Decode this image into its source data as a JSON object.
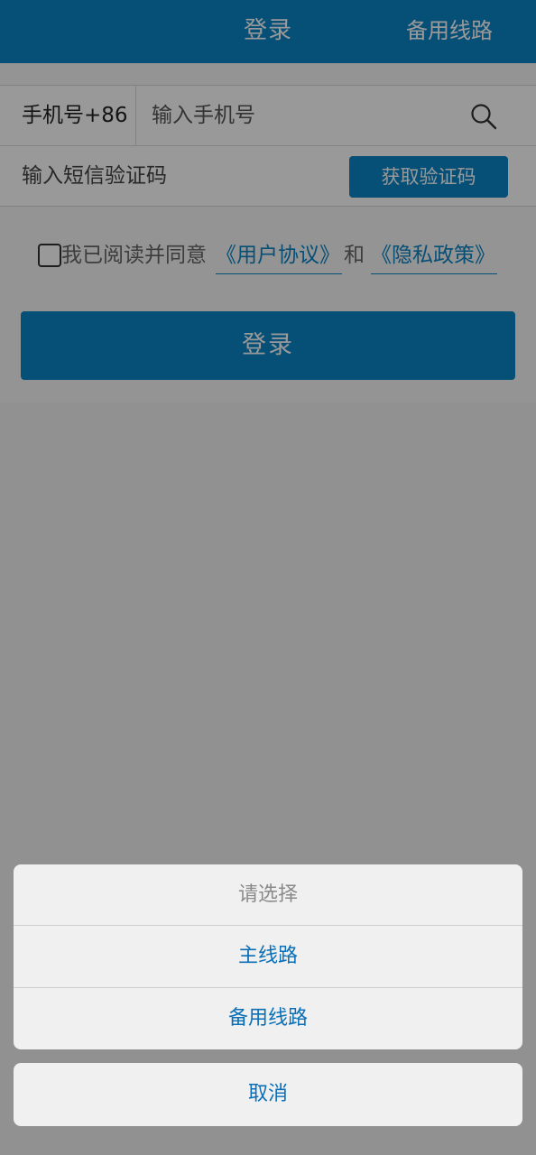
{
  "header": {
    "title": "登录",
    "action": "备用线路"
  },
  "login_form": {
    "phone_prefix": "手机号+86",
    "phone_placeholder": "输入手机号",
    "code_placeholder": "输入短信验证码",
    "get_code_label": "获取验证码",
    "agree_prefix": "我已阅读并同意",
    "user_agreement": "《用户协议》",
    "and": "和",
    "privacy_policy": "《隐私政策》",
    "login_label": "登录"
  },
  "action_sheet": {
    "title": "请选择",
    "options": [
      "主线路",
      "备用线路"
    ],
    "cancel": "取消"
  },
  "colors": {
    "primary": "#0a84c7",
    "link": "#0a6fb7"
  }
}
